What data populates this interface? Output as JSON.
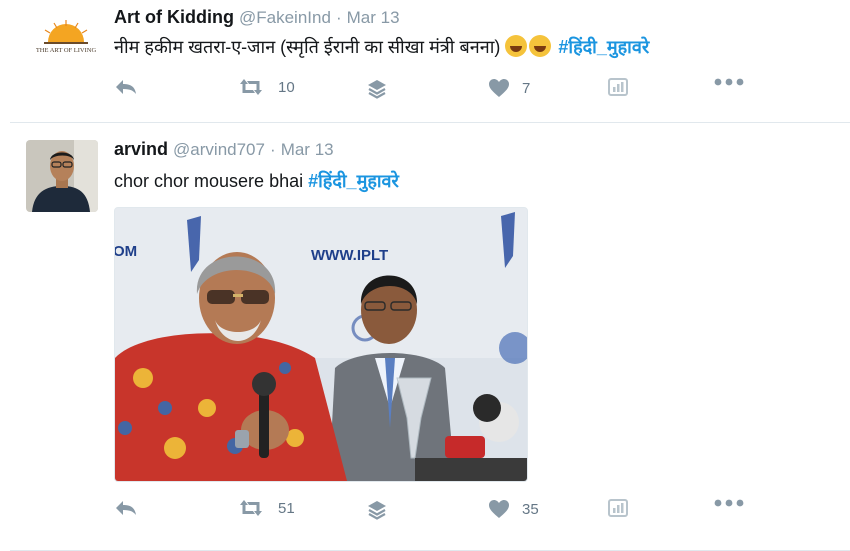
{
  "tweets": [
    {
      "name": "Art of Kidding",
      "handle": "@FakeinInd",
      "separator": "·",
      "time": "Mar 13",
      "text": "नीम हकीम खतरा-ए-जान (स्मृति ईरानी का सीखा मंत्री बनना) ",
      "hashtag": "#हिंदी_मुहावरे",
      "avatar_text": "THE ART OF LIVING",
      "retweet_count": "10",
      "like_count": "7"
    },
    {
      "name": "arvind",
      "handle": "@arvind707",
      "separator": "·",
      "time": "Mar 13",
      "text": "chor chor mousere bhai ",
      "hashtag": "#हिंदी_मुहावरे",
      "media_text": "WWW.IPLT",
      "media_text_left": "OM",
      "retweet_count": "51",
      "like_count": "35"
    }
  ],
  "colors": {
    "link": "#1b95e0",
    "muted": "#8899a6",
    "border": "#e1e8ed"
  }
}
